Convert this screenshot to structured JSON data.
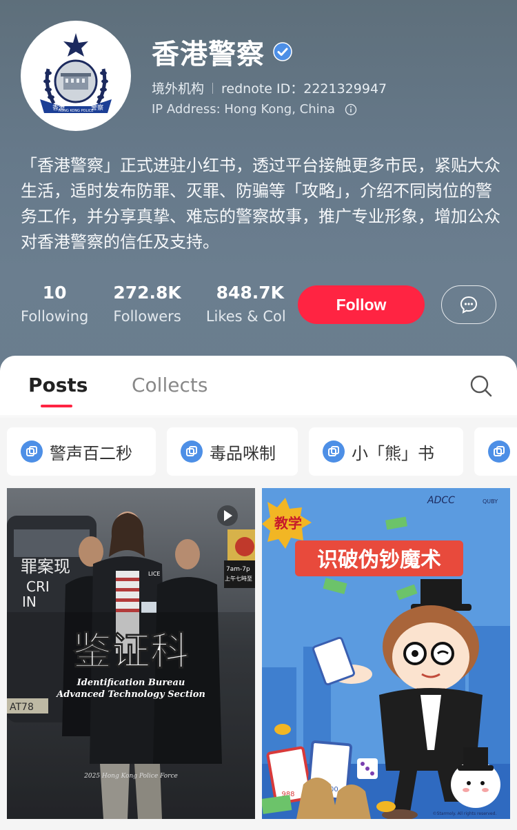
{
  "profile": {
    "name": "香港警察",
    "org_type": "境外机构",
    "rednote_id": "rednote ID：2221329947",
    "ip_address": "IP Address: Hong Kong, China",
    "bio": "「香港警察」正式进驻小红书，透过平台接触更多市民，紧贴大众生活，适时发布防罪、灭罪、防骗等「攻略」，介绍不同岗位的警务工作，并分享真挚、难忘的警察故事，推广专业形象，增加公众对香港警察的信任及支持。",
    "logo_text_left": "香港",
    "logo_text_right": "警察",
    "logo_text_bottom": "HONG KONG POLICE"
  },
  "stats": {
    "following": {
      "num": "10",
      "label": "Following"
    },
    "followers": {
      "num": "272.8K",
      "label": "Followers"
    },
    "likes": {
      "num": "848.7K",
      "label": "Likes & Col"
    }
  },
  "actions": {
    "follow_label": "Follow"
  },
  "tabs": {
    "posts": "Posts",
    "collects": "Collects"
  },
  "chips": [
    {
      "label": "警声百二秒"
    },
    {
      "label": "毒品咪制"
    },
    {
      "label": "小「熊」书"
    }
  ],
  "posts": [
    {
      "title_cn": "鉴证科",
      "title_en1": "Identification Bureau",
      "title_en2": "Advanced Technology Section",
      "footer": "2025 Hong Kong Police Force",
      "bg_text1": "罪案现",
      "bg_text2": "CRI",
      "bg_text3": "IN",
      "sign_text1": "7am-7p",
      "sign_text2": "上午七時至",
      "badge_text": "LICE",
      "plate_text": "AT78"
    },
    {
      "badge": "教学",
      "title": "识破伪钞魔术",
      "logo": "ADCC",
      "logo2": "QUBY",
      "copyright": "©Starmoly. All rights reserved.",
      "card1": "988",
      "card2": "1000"
    }
  ],
  "colors": {
    "accent": "#ff2442",
    "verified": "#4d8fe6"
  }
}
